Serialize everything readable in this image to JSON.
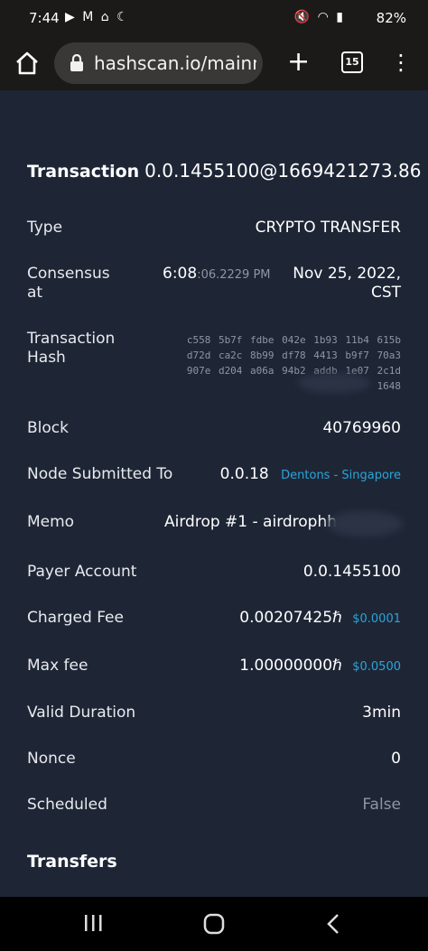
{
  "status_bar": {
    "time": "7:44",
    "left_icons": "▶ M ⌂ ☾",
    "right_icons": "🔇 ◠ ▮",
    "battery": "82%"
  },
  "browser": {
    "url": "hashscan.io/mainne",
    "tab_count": "15"
  },
  "transaction": {
    "title_label": "Transaction",
    "title_value": "0.0.1455100@1669421273.86",
    "rows": {
      "type": {
        "label": "Type",
        "value": "CRYPTO TRANSFER"
      },
      "consensus": {
        "label_line1": "Consensus",
        "label_line2": "at",
        "time_main": "6:08",
        "time_sub": ":06.2229 PM",
        "date_line1": "Nov 25, 2022,",
        "date_line2": "CST"
      },
      "hash": {
        "label_line1": "Transaction",
        "label_line2": "Hash",
        "line1": "c558 5b7f fdbe 042e 1b93 11b4 615b",
        "line2": "d72d ca2c 8b99 df78 4413 b9f7 70a3",
        "line3": "907e d204 a06a 94b2 addb 1e07 2c1d",
        "line4": "1648"
      },
      "block": {
        "label": "Block",
        "value": "40769960"
      },
      "node": {
        "label": "Node Submitted To",
        "value": "0.0.18",
        "link": "Dentons - Singapore"
      },
      "memo": {
        "label": "Memo",
        "value": "Airdrop #1 - airdrophh"
      },
      "payer": {
        "label": "Payer Account",
        "value": "0.0.1455100"
      },
      "charged_fee": {
        "label": "Charged Fee",
        "value": "0.00207425ℏ",
        "usd": "$0.0001"
      },
      "max_fee": {
        "label": "Max fee",
        "value": "1.00000000ℏ",
        "usd": "$0.0500"
      },
      "valid_duration": {
        "label": "Valid Duration",
        "value": "3min"
      },
      "nonce": {
        "label": "Nonce",
        "value": "0"
      },
      "scheduled": {
        "label": "Scheduled",
        "value": "False"
      }
    },
    "transfers_heading": "Transfers"
  },
  "colors": {
    "page_bg": "#1e2636",
    "chrome_bg": "#1b1a19",
    "link_blue": "#2aa5d9",
    "muted_grey": "#8e96a3"
  },
  "icons": [
    "home-icon",
    "lock-icon",
    "plus-icon",
    "tabs-icon",
    "more-vert-icon",
    "recent-apps-icon",
    "home-circle-icon",
    "back-chevron-icon"
  ]
}
